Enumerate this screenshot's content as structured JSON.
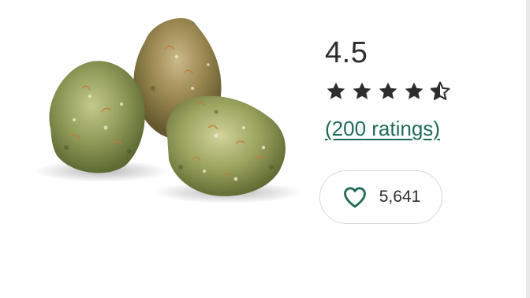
{
  "product": {
    "image": "cannabis-buds-icon"
  },
  "rating": {
    "value": "4.5",
    "stars": 4.5,
    "max_stars": 5,
    "ratings_link": "(200 ratings)"
  },
  "favorite": {
    "count": "5,641",
    "icon": "heart-outline-icon"
  },
  "colors": {
    "accent": "#1f6b57",
    "star": "#2d2d2d",
    "border": "#d9d9d9"
  }
}
